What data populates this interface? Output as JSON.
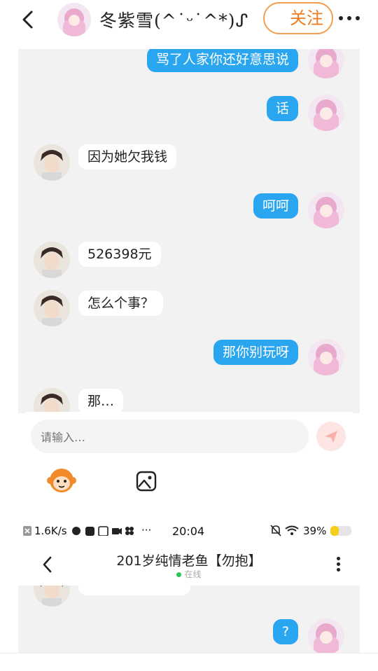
{
  "header": {
    "nickname": "冬紫雪(^˙ᵕ˙^*)ᔑ",
    "follow_label": "关注"
  },
  "messages": [
    {
      "dir": "out",
      "text": "骂了人家你还好意思说"
    },
    {
      "dir": "out",
      "text": "话"
    },
    {
      "dir": "in",
      "text": "因为她欠我钱"
    },
    {
      "dir": "out",
      "text": "呵呵"
    },
    {
      "dir": "in",
      "text": "526398元"
    },
    {
      "dir": "in",
      "text": "怎么个事？"
    },
    {
      "dir": "out",
      "text": "那你别玩呀"
    },
    {
      "dir": "in",
      "text": "那…"
    }
  ],
  "input": {
    "placeholder": "请输入…"
  },
  "status_bar": {
    "speed": "1.6K/s",
    "dots": "···",
    "time": "20:04",
    "battery": "39%"
  },
  "header2": {
    "title": "201岁纯情老鱼【勿抱】",
    "status": "在线"
  },
  "messages2": [
    {
      "dir": "out",
      "text": "?"
    }
  ],
  "colors": {
    "out_bubble": "#2aa6f0",
    "accent": "#f07a1a",
    "online_dot": "#2bc45a"
  }
}
